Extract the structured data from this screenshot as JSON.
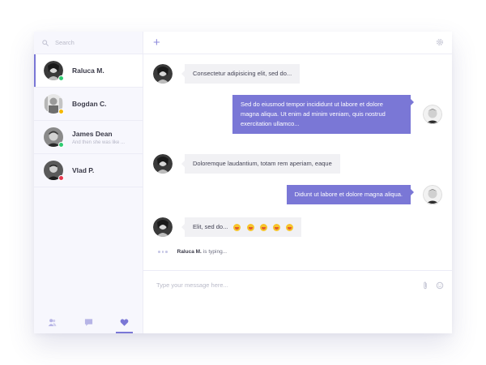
{
  "colors": {
    "accent": "#7a77d6",
    "online": "#2ecc71",
    "away": "#f5b800",
    "busy": "#e8384f"
  },
  "search": {
    "placeholder": "Search"
  },
  "contacts": [
    {
      "name": "Raluca M.",
      "preview": "",
      "status": "online",
      "active": true
    },
    {
      "name": "Bogdan C.",
      "preview": "",
      "status": "away",
      "active": false
    },
    {
      "name": "James Dean",
      "preview": "And then she was like ...",
      "status": "online",
      "active": false
    },
    {
      "name": "Vlad P.",
      "preview": "",
      "status": "busy",
      "active": false
    }
  ],
  "bottom_tabs": [
    {
      "icon": "contacts-icon",
      "active": false
    },
    {
      "icon": "chat-bubble-icon",
      "active": false
    },
    {
      "icon": "heart-icon",
      "active": true
    }
  ],
  "header": {
    "add_icon": "plus-icon",
    "settings_icon": "gear-icon"
  },
  "messages": [
    {
      "side": "in",
      "text": "Consectetur adipisicing elit, sed do..."
    },
    {
      "side": "out",
      "text": "Sed do eiusmod tempor incididunt ut labore et dolore magna aliqua. Ut enim ad minim veniam, quis nostrud exercitation ullamco..."
    },
    {
      "side": "in",
      "text": "Doloremque laudantium, totam rem aperiam, eaque"
    },
    {
      "side": "out",
      "text": "Didunt ut labore et dolore magna aliqua."
    },
    {
      "side": "in",
      "text": "Elit, sed do...",
      "emoji_count": 5
    }
  ],
  "typing": {
    "name": "Raluca M.",
    "suffix": "is typing..."
  },
  "composer": {
    "placeholder": "Type your message here...",
    "icons": [
      "paperclip-icon",
      "emoji-icon"
    ]
  }
}
